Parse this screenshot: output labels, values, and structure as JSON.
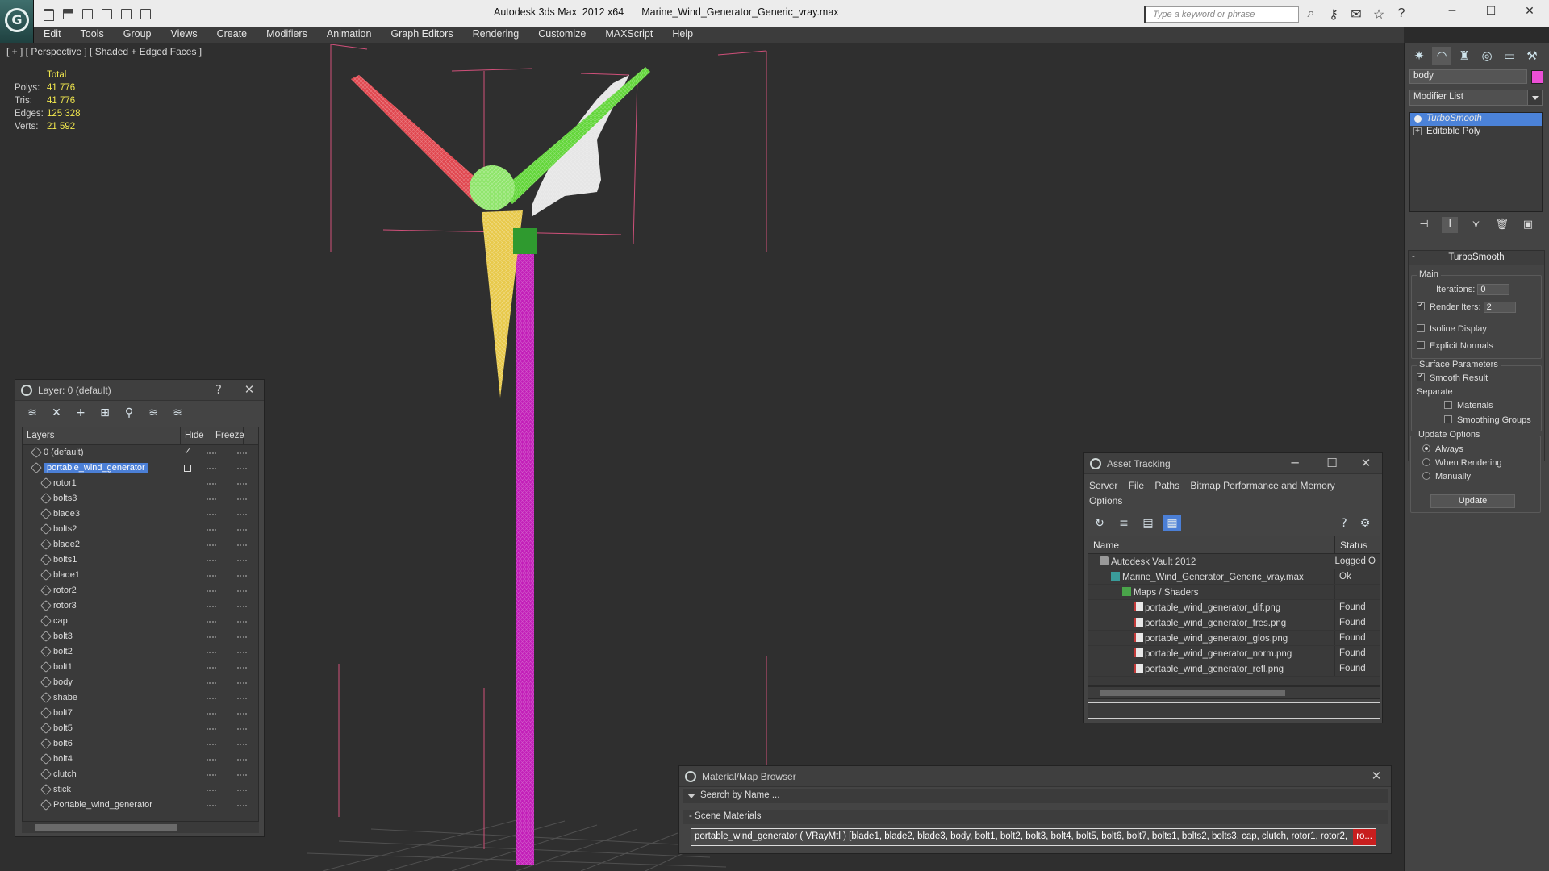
{
  "titlebar": {
    "app": "Autodesk 3ds Max  2012 x64",
    "file": "Marine_Wind_Generator_Generic_vray.max",
    "search_placeholder": "Type a keyword or phrase"
  },
  "menu": [
    "Edit",
    "Tools",
    "Group",
    "Views",
    "Create",
    "Modifiers",
    "Animation",
    "Graph Editors",
    "Rendering",
    "Customize",
    "MAXScript",
    "Help"
  ],
  "viewport": {
    "label": "[ + ] [ Perspective ] [ Shaded + Edged Faces ]",
    "stats": {
      "header": "Total",
      "rows": [
        {
          "label": "Polys:",
          "value": "41 776"
        },
        {
          "label": "Tris:",
          "value": "41 776"
        },
        {
          "label": "Edges:",
          "value": "125 328"
        },
        {
          "label": "Verts:",
          "value": "21 592"
        }
      ]
    }
  },
  "layer_window": {
    "title": "Layer: 0 (default)",
    "help": "?",
    "close": "✕",
    "columns": {
      "name": "Layers",
      "hide": "Hide",
      "freeze": "Freeze"
    },
    "layers": [
      {
        "name": "0 (default)",
        "type": "layer",
        "current": true
      },
      {
        "name": "portable_wind_generator",
        "type": "layer",
        "selected": true
      },
      {
        "name": "rotor1",
        "type": "object"
      },
      {
        "name": "bolts3",
        "type": "object"
      },
      {
        "name": "blade3",
        "type": "object"
      },
      {
        "name": "bolts2",
        "type": "object"
      },
      {
        "name": "blade2",
        "type": "object"
      },
      {
        "name": "bolts1",
        "type": "object"
      },
      {
        "name": "blade1",
        "type": "object"
      },
      {
        "name": "rotor2",
        "type": "object"
      },
      {
        "name": "rotor3",
        "type": "object"
      },
      {
        "name": "cap",
        "type": "object"
      },
      {
        "name": "bolt3",
        "type": "object"
      },
      {
        "name": "bolt2",
        "type": "object"
      },
      {
        "name": "bolt1",
        "type": "object"
      },
      {
        "name": "body",
        "type": "object"
      },
      {
        "name": "shabe",
        "type": "object"
      },
      {
        "name": "bolt7",
        "type": "object"
      },
      {
        "name": "bolt5",
        "type": "object"
      },
      {
        "name": "bolt6",
        "type": "object"
      },
      {
        "name": "bolt4",
        "type": "object"
      },
      {
        "name": "clutch",
        "type": "object"
      },
      {
        "name": "stick",
        "type": "object"
      },
      {
        "name": "Portable_wind_generator",
        "type": "object"
      }
    ]
  },
  "asset_window": {
    "title": "Asset Tracking",
    "menu": [
      "Server",
      "File",
      "Paths",
      "Bitmap Performance and Memory",
      "Options"
    ],
    "columns": {
      "name": "Name",
      "status": "Status"
    },
    "rows": [
      {
        "name": "Autodesk Vault 2012",
        "status": "Logged O",
        "icon": "vault-icon",
        "indent": 1
      },
      {
        "name": "Marine_Wind_Generator_Generic_vray.max",
        "status": "Ok",
        "icon": "max-file-icon",
        "indent": 2
      },
      {
        "name": "Maps / Shaders",
        "status": "",
        "icon": "maps-icon",
        "indent": 3
      },
      {
        "name": "portable_wind_generator_dif.png",
        "status": "Found",
        "icon": "png-icon",
        "indent": 4
      },
      {
        "name": "portable_wind_generator_fres.png",
        "status": "Found",
        "icon": "png-icon",
        "indent": 4
      },
      {
        "name": "portable_wind_generator_glos.png",
        "status": "Found",
        "icon": "png-icon",
        "indent": 4
      },
      {
        "name": "portable_wind_generator_norm.png",
        "status": "Found",
        "icon": "png-icon",
        "indent": 4
      },
      {
        "name": "portable_wind_generator_refl.png",
        "status": "Found",
        "icon": "png-icon",
        "indent": 4
      }
    ]
  },
  "material_browser": {
    "title": "Material/Map Browser",
    "search_placeholder": "Search by Name ...",
    "section": "- Scene Materials",
    "entry": "portable_wind_generator ( VRayMtl ) [blade1, blade2, blade3, body, bolt1, bolt2, bolt3, bolt4, bolt5, bolt6, bolt7, bolts1, bolts2, bolts3, cap, clutch, rotor1, rotor2,",
    "entry_tail": "ro..."
  },
  "command_panel": {
    "object_name": "body",
    "object_color": "#ec4fd6",
    "modifier_list": "Modifier List",
    "stack": [
      {
        "name": "TurboSmooth",
        "selected": true
      },
      {
        "name": "Editable Poly",
        "selected": false
      }
    ],
    "rollout_title": "TurboSmooth",
    "main_group": "Main",
    "iterations_label": "Iterations:",
    "iterations_value": "0",
    "render_iters_label": "Render Iters:",
    "render_iters_value": "2",
    "render_iters_checked": true,
    "isoline_label": "Isoline Display",
    "explicit_normals_label": "Explicit Normals",
    "surface_group": "Surface Parameters",
    "smooth_result_label": "Smooth Result",
    "smooth_result_checked": true,
    "separate_label": "Separate",
    "materials_label": "Materials",
    "smoothing_groups_label": "Smoothing Groups",
    "update_group": "Update Options",
    "always_label": "Always",
    "when_rendering_label": "When Rendering",
    "manually_label": "Manually",
    "update_option_selected": "Always",
    "update_button": "Update"
  },
  "colors": {
    "pole": "#c21fb8",
    "blade_red": "#e0474f",
    "blade_green": "#63d63a",
    "blade_yellow": "#e8c94a",
    "selection_blue": "#4b7fd6",
    "stats_yellow": "#f2e84e"
  }
}
